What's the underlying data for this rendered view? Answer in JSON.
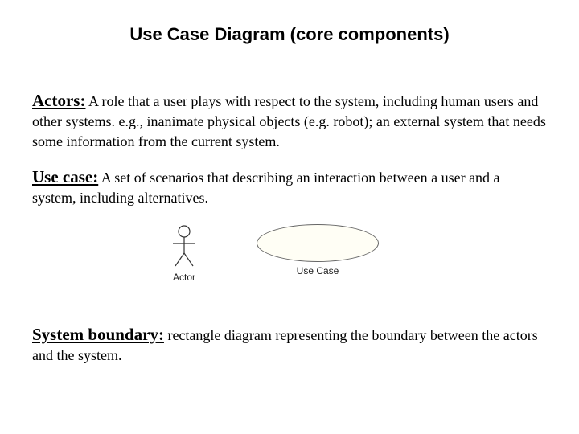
{
  "title": "Use Case Diagram (core components)",
  "actors": {
    "term": "Actors:",
    "definition": " A role that a user plays with respect to the system, including human users and other systems. e.g., inanimate physical objects (e.g. robot); an external system that needs some information from the current system."
  },
  "usecase": {
    "term": "Use case:",
    "definition": " A set of scenarios that describing an interaction  between a user and a system, including alternatives."
  },
  "diagram": {
    "actor_label": "Actor",
    "usecase_label": "Use Case"
  },
  "boundary": {
    "term": "System boundary:",
    "definition": " rectangle diagram representing the boundary between the actors and the system."
  }
}
